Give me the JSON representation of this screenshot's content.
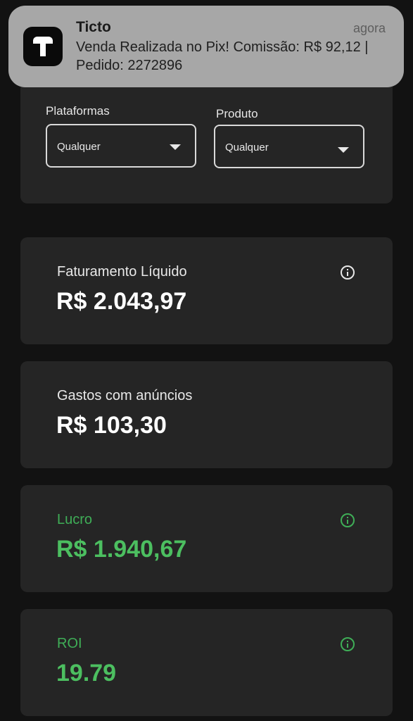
{
  "notification": {
    "app_name": "Ticto",
    "time": "agora",
    "message": "Venda Realizada no Pix! Comissão: R$ 92,12 | Pedido: 2272896",
    "icon": "ticto-logo-icon"
  },
  "filters": {
    "platforms": {
      "label": "Plataformas",
      "selected": "Qualquer"
    },
    "product": {
      "label": "Produto",
      "selected": "Qualquer"
    }
  },
  "stats": {
    "net_revenue": {
      "label": "Faturamento Líquido",
      "value": "R$ 2.043,97",
      "has_info": true
    },
    "ad_spend": {
      "label": "Gastos com anúncios",
      "value": "R$ 103,30",
      "has_info": false
    },
    "profit": {
      "label": "Lucro",
      "value": "R$ 1.940,67",
      "has_info": true
    },
    "roi": {
      "label": "ROI",
      "value": "19.79",
      "has_info": true
    }
  },
  "colors": {
    "background": "#121212",
    "card": "#252525",
    "positive": "#4cbf60",
    "notification_bg": "#a7a7a7"
  }
}
